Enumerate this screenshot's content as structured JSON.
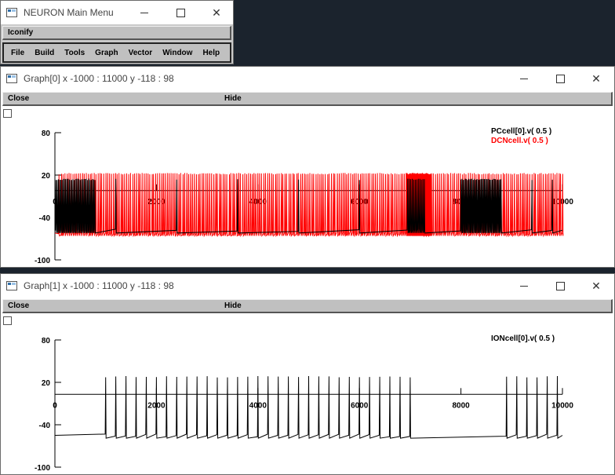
{
  "main_menu": {
    "title": "NEURON Main Menu",
    "iconify": "Iconify",
    "menu": [
      "File",
      "Build",
      "Tools",
      "Graph",
      "Vector",
      "Window",
      "Help"
    ]
  },
  "graphs": [
    {
      "title": "Graph[0]  x -1000 : 11000  y -118 : 98",
      "close": "Close",
      "hide": "Hide",
      "yticks": [
        "80",
        "20",
        "-40",
        "-100"
      ],
      "xticks": [
        "0",
        "2000",
        "4000",
        "6000",
        "8000",
        "10000"
      ],
      "legend": [
        {
          "text": "PCcell[0].v( 0.5 )",
          "color": "#000000"
        },
        {
          "text": "DCNcell.v( 0.5 )",
          "color": "#ff0000"
        }
      ]
    },
    {
      "title": "Graph[1]  x -1000 : 11000  y -118 : 98",
      "close": "Close",
      "hide": "Hide",
      "yticks": [
        "80",
        "20",
        "-40",
        "-100"
      ],
      "xticks": [
        "0",
        "2000",
        "4000",
        "6000",
        "8000",
        "10000"
      ],
      "legend": [
        {
          "text": "IONcell[0].v( 0.5 )",
          "color": "#000000"
        }
      ]
    }
  ],
  "chart_data": [
    {
      "type": "line",
      "title": "Graph[0]  x -1000 : 11000  y -118 : 98",
      "xlim": [
        -1000,
        11000
      ],
      "ylim": [
        -118,
        98
      ],
      "series": [
        {
          "name": "PCcell[0].v( 0.5 )",
          "color": "#000000",
          "baseline": -58,
          "peak": 20,
          "description_values": "dense spiking trains between ~0-800 ms, 6900-7300 ms, 8000-8800 ms"
        },
        {
          "name": "DCNcell.v( 0.5 )",
          "color": "#ff0000",
          "baseline": -62,
          "peak": 22,
          "description_values": "continuous spiking from 0 to 10000 ms, dense burst near 7000 ms"
        }
      ]
    },
    {
      "type": "line",
      "title": "Graph[1]  x -1000 : 11000  y -118 : 98",
      "xlim": [
        -1000,
        11000
      ],
      "ylim": [
        -118,
        98
      ],
      "series": [
        {
          "name": "IONcell[0].v( 0.5 )",
          "color": "#000000",
          "baseline": -55,
          "peak": 28,
          "spike_times": [
            1000,
            1200,
            1400,
            1600,
            1800,
            2000,
            2200,
            2400,
            2600,
            2800,
            3000,
            3200,
            3400,
            3600,
            3800,
            4000,
            4200,
            4400,
            4600,
            4800,
            5000,
            5200,
            5400,
            5600,
            5800,
            6000,
            6200,
            6400,
            6600,
            6800,
            7000,
            8900,
            9100,
            9300,
            9500,
            9700,
            9900
          ]
        }
      ]
    }
  ]
}
